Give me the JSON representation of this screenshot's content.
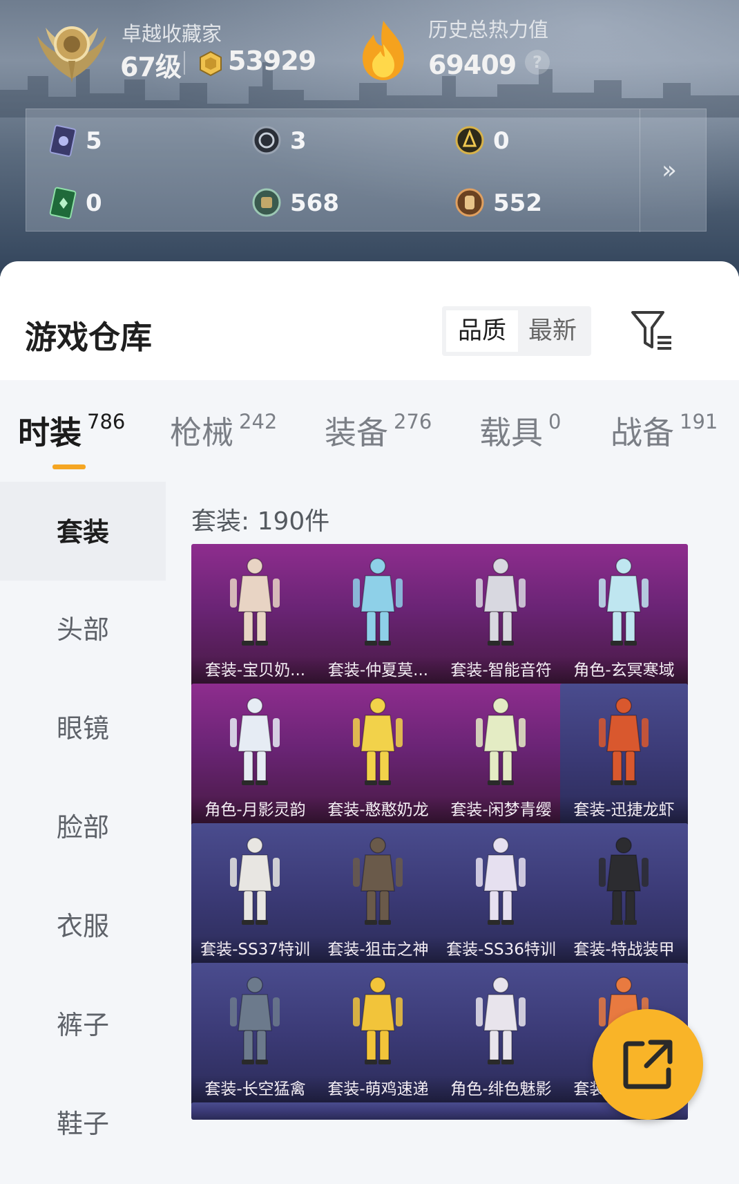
{
  "profile": {
    "rank_title": "卓越收藏家",
    "level": "67级",
    "coins": "53929",
    "heat_title": "历史总热力值",
    "heat_value": "69409",
    "help": "?"
  },
  "stats": [
    {
      "icon": "ticket-purple-icon",
      "value": "5"
    },
    {
      "icon": "silver-coin-icon",
      "value": "3"
    },
    {
      "icon": "gold-badge-icon",
      "value": "0"
    },
    {
      "icon": "ticket-green-icon",
      "value": "0"
    },
    {
      "icon": "jade-coin-icon",
      "value": "568"
    },
    {
      "icon": "bronze-coin-icon",
      "value": "552"
    }
  ],
  "warehouse": {
    "title": "游戏仓库",
    "sort": {
      "quality": "品质",
      "latest": "最新"
    }
  },
  "tabs": [
    {
      "label": "时装",
      "count": "786"
    },
    {
      "label": "枪械",
      "count": "242"
    },
    {
      "label": "装备",
      "count": "276"
    },
    {
      "label": "载具",
      "count": "0"
    },
    {
      "label": "战备",
      "count": "191"
    }
  ],
  "side_nav": [
    "套装",
    "头部",
    "眼镜",
    "脸部",
    "衣服",
    "裤子",
    "鞋子"
  ],
  "list": {
    "count_label": "套装: 190件",
    "items": [
      {
        "name": "套装-宝贝奶...",
        "rarity": "purple",
        "color": "#e8d4c4"
      },
      {
        "name": "套装-仲夏莫...",
        "rarity": "purple",
        "color": "#8ed0e8"
      },
      {
        "name": "套装-智能音符",
        "rarity": "purple",
        "color": "#d8d8e0"
      },
      {
        "name": "角色-玄冥寒域",
        "rarity": "purple",
        "color": "#bfe6f0"
      },
      {
        "name": "角色-月影灵韵",
        "rarity": "purple",
        "color": "#e6ecf4"
      },
      {
        "name": "套装-憨憨奶龙",
        "rarity": "purple",
        "color": "#f2d24a"
      },
      {
        "name": "套装-闲梦青缨",
        "rarity": "purple",
        "color": "#e4ecc4"
      },
      {
        "name": "套装-迅捷龙虾",
        "rarity": "blue",
        "color": "#d9582e"
      },
      {
        "name": "套装-SS37特训",
        "rarity": "blue",
        "color": "#e8e6e2"
      },
      {
        "name": "套装-狙击之神",
        "rarity": "blue",
        "color": "#6a5a4a"
      },
      {
        "name": "套装-SS36特训",
        "rarity": "blue",
        "color": "#e6e0f0"
      },
      {
        "name": "套装-特战装甲",
        "rarity": "blue",
        "color": "#2c2c30"
      },
      {
        "name": "套装-长空猛禽",
        "rarity": "blue",
        "color": "#6c7a8c"
      },
      {
        "name": "套装-萌鸡速递",
        "rarity": "blue",
        "color": "#f2c43a"
      },
      {
        "name": "角色-绯色魅影",
        "rarity": "blue",
        "color": "#e8e4ec"
      },
      {
        "name": "套装-旭日情侣",
        "rarity": "blue",
        "color": "#e87a40"
      }
    ]
  }
}
